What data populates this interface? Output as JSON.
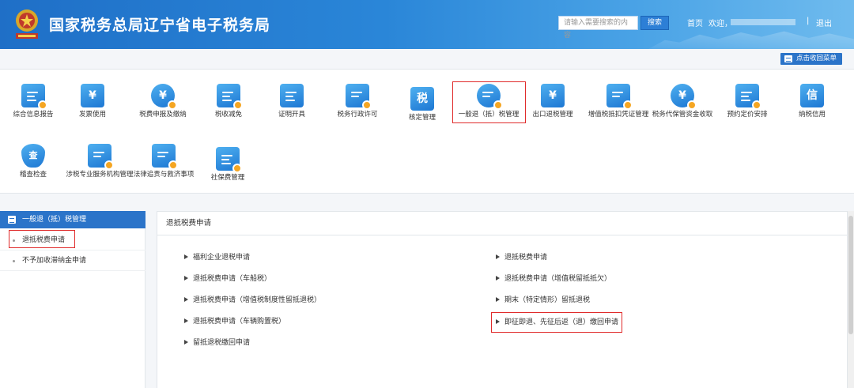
{
  "header": {
    "site_title": "国家税务总局辽宁省电子税务局",
    "search_placeholder": "请输入需要搜索的内容",
    "search_button": "搜索",
    "nav_home": "首页",
    "nav_welcome": "欢迎，",
    "nav_separator": "|",
    "nav_logout": "退出"
  },
  "collapse_button": "点击收回菜单",
  "menu_tiles": [
    {
      "label": "综合信息报告",
      "icon": "report-icon"
    },
    {
      "label": "发票使用",
      "icon": "invoice-icon"
    },
    {
      "label": "税费申报及缴纳",
      "icon": "tax-payment-icon"
    },
    {
      "label": "税收减免",
      "icon": "tax-relief-icon"
    },
    {
      "label": "证明开具",
      "icon": "certificate-icon"
    },
    {
      "label": "税务行政许可",
      "icon": "permit-icon"
    },
    {
      "label": "核定管理",
      "icon": "assessment-icon",
      "glyph": "税"
    },
    {
      "label": "一般退（抵）税管理",
      "icon": "refund-icon"
    },
    {
      "label": "出口退税管理",
      "icon": "export-refund-icon"
    },
    {
      "label": "增值税抵扣凭证管理",
      "icon": "vat-deduction-icon"
    },
    {
      "label": "税务代保管资金收取",
      "icon": "custody-fund-icon"
    },
    {
      "label": "预约定价安排",
      "icon": "pricing-agreement-icon"
    },
    {
      "label": "纳税信用",
      "icon": "credit-icon",
      "glyph": "信"
    },
    {
      "label": "稽查检查",
      "icon": "inspection-icon",
      "glyph": "查"
    },
    {
      "label": "涉税专业服务机构管理",
      "icon": "agency-icon"
    },
    {
      "label": "法律追责与救济事项",
      "icon": "legal-icon"
    },
    {
      "label": "社保费管理",
      "icon": "social-security-icon"
    }
  ],
  "leftnav": {
    "title": "一般退（抵）税管理",
    "items": [
      "退抵税费申请",
      "不予加收滞纳金申请"
    ]
  },
  "main": {
    "title": "退抵税费申请",
    "links_left": [
      "福利企业退税申请",
      "退抵税费申请（车船税）",
      "退抵税费申请（增值税制度性留抵退税）",
      "退抵税费申请（车辆购置税）",
      "留抵退税缴回申请"
    ],
    "links_right": [
      "退抵税费申请",
      "退抵税费申请（增值税留抵抵欠）",
      "期末（特定情形）留抵退税",
      "即征即退、先征后返（退）缴回申请"
    ]
  },
  "colors": {
    "accent": "#2b74c9",
    "highlight": "#e02b2b"
  }
}
